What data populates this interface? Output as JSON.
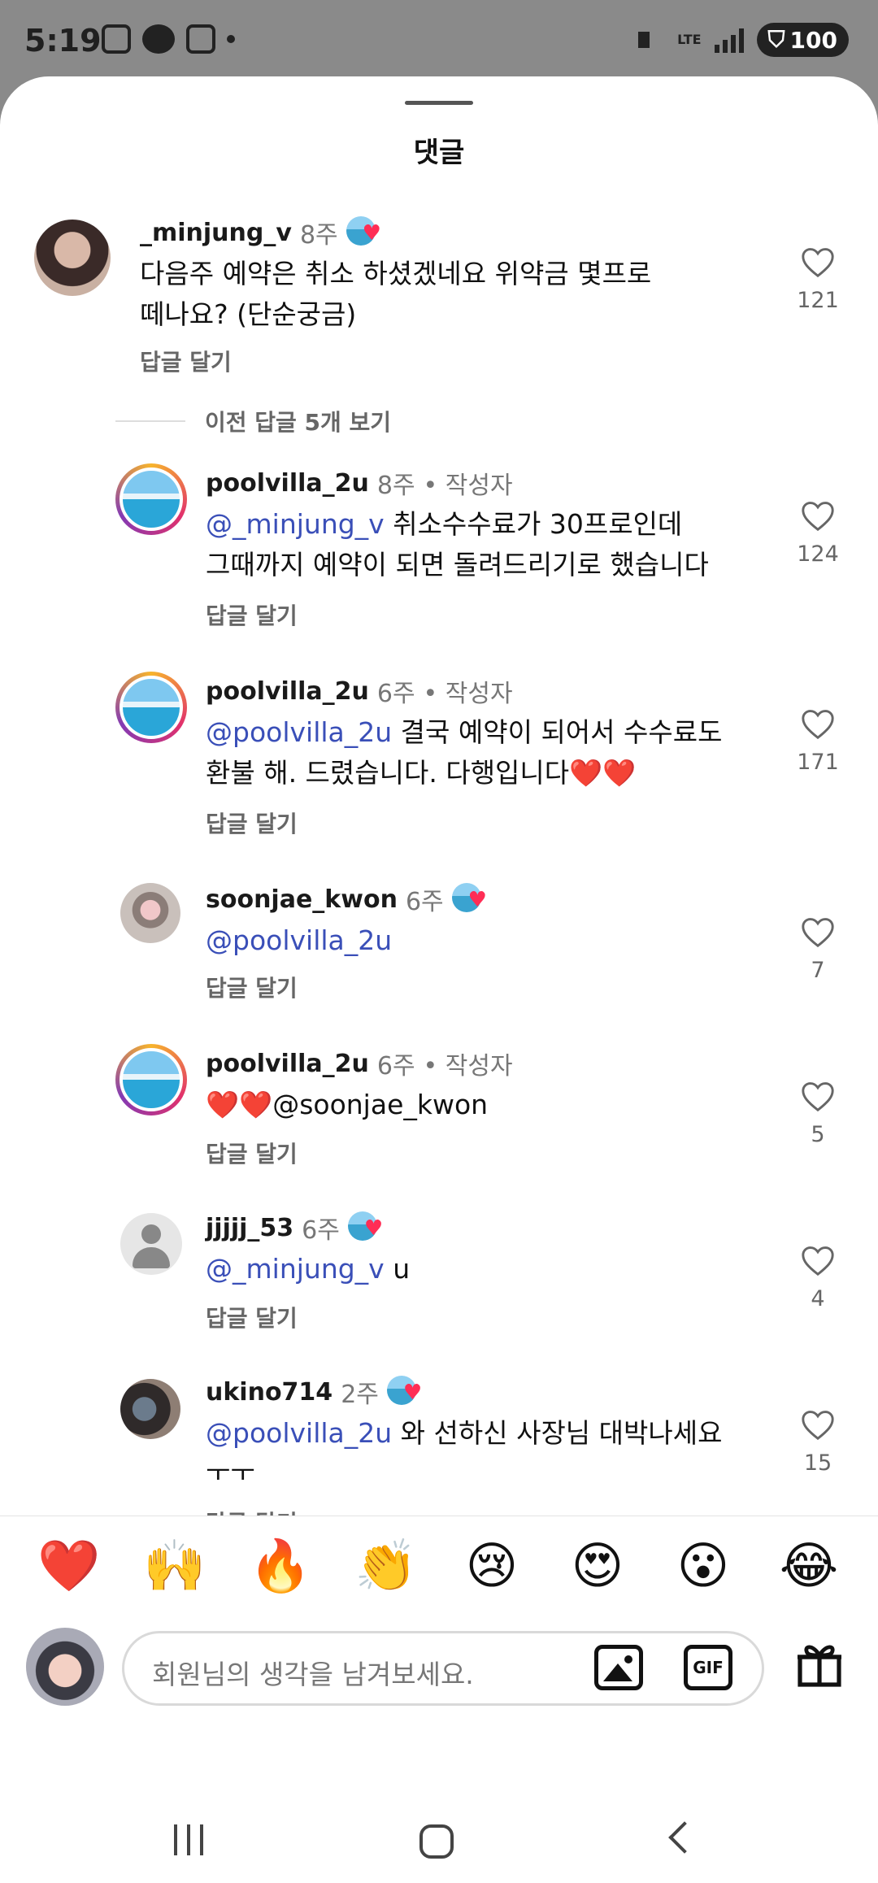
{
  "status_bar": {
    "time": "5:19",
    "network": "LTE",
    "battery": "100"
  },
  "sheet": {
    "title": "댓글"
  },
  "comments": [
    {
      "username": "_minjung_v",
      "time": "8주",
      "text_lines": [
        "다음주 예약은 취소 하셨겠네요 위약금 몇프로",
        "떼나요? (단순궁금)"
      ],
      "reply_label": "답글 달기",
      "likes": "121"
    }
  ],
  "view_previous": "이전 답글 5개 보기",
  "replies": [
    {
      "username": "poolvilla_2u",
      "time": "8주",
      "author_label": "• 작성자",
      "mention": "@_minjung_v",
      "text_line1": " 취소수수료가 30프로인데",
      "text_line2": "그때까지 예약이 되면 돌려드리기로 했습니다",
      "reply_label": "답글 달기",
      "likes": "124"
    },
    {
      "username": "poolvilla_2u",
      "time": "6주",
      "author_label": "• 작성자",
      "mention": "@poolvilla_2u",
      "text_line1": " 결국 예약이 되어서 수수료도",
      "text_line2": "환불 해. 드렸습니다. 다행입니다❤️❤️",
      "reply_label": "답글 달기",
      "likes": "171"
    },
    {
      "username": "soonjae_kwon",
      "time": "6주",
      "mention": "@poolvilla_2u",
      "reply_label": "답글 달기",
      "likes": "7"
    },
    {
      "username": "poolvilla_2u",
      "time": "6주",
      "author_label": "• 작성자",
      "text_prefix": "❤️❤️",
      "mention": "@soonjae_kwon",
      "reply_label": "답글 달기",
      "likes": "5"
    },
    {
      "username": "jjjjj_53",
      "time": "6주",
      "mention": "@_minjung_v",
      "text_line1": " u",
      "reply_label": "답글 달기",
      "likes": "4"
    },
    {
      "username": "ukino714",
      "time": "2주",
      "mention": "@poolvilla_2u",
      "text_line1": " 와 선하신 사장님 대박나세요",
      "text_line2": "ㅜㅜ",
      "reply_label": "답글 달기",
      "likes": "15"
    }
  ],
  "emoji_bar": [
    "❤️",
    "🙌",
    "🔥",
    "👏",
    "😢",
    "😍",
    "😮",
    "😂"
  ],
  "composer": {
    "placeholder": "회원님의 생각을 남겨보세요.",
    "gif_label": "GIF"
  },
  "icons": {
    "like": "heart-outline-icon",
    "image": "image-icon",
    "gift": "gift-icon"
  }
}
